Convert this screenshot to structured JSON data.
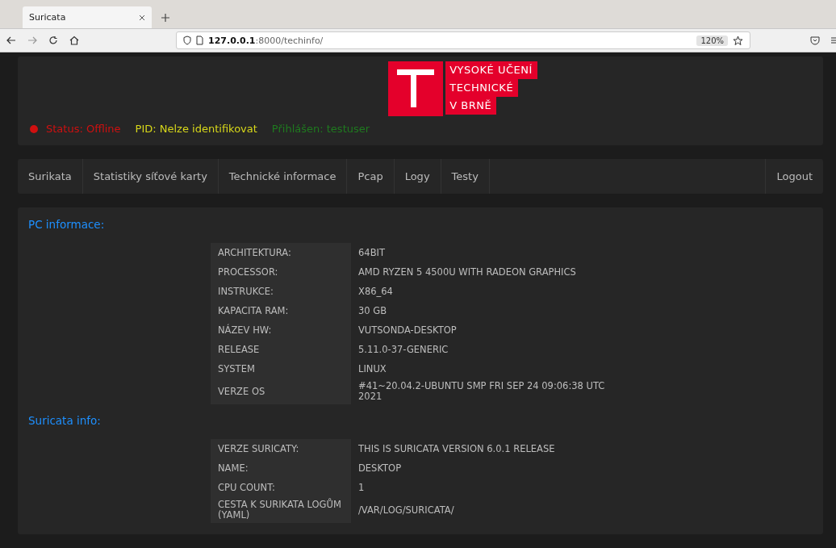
{
  "browser": {
    "tab_title": "Suricata",
    "url_host": "127.0.0.1",
    "url_rest": ":8000/techinfo/",
    "zoom": "120%"
  },
  "logo": {
    "lines": [
      "VYSOKÉ UČENÍ",
      "TECHNICKÉ",
      "V BRNĚ"
    ]
  },
  "status": [
    {
      "text": "Status: Offline",
      "color": "#d01010",
      "dot": true
    },
    {
      "text": "PID: Nelze identifikovat",
      "color": "#d8d81a",
      "dot": false
    },
    {
      "text": "Přihlášen: testuser",
      "color": "#1f7a1f",
      "dot": false
    }
  ],
  "nav": {
    "items": [
      "Surikata",
      "Statistiky síťové karty",
      "Technické informace",
      "Pcap",
      "Logy",
      "Testy"
    ],
    "right": "Logout"
  },
  "sections": [
    {
      "title": "PC informace:",
      "rows": [
        {
          "label": "ARCHITEKTURA:",
          "value": "64BIT"
        },
        {
          "label": "PROCESSOR:",
          "value": "AMD RYZEN 5 4500U WITH RADEON GRAPHICS"
        },
        {
          "label": "INSTRUKCE:",
          "value": "X86_64"
        },
        {
          "label": "KAPACITA RAM:",
          "value": "30 GB"
        },
        {
          "label": "NÁZEV HW:",
          "value": "VUTSONDA-DESKTOP"
        },
        {
          "label": "RELEASE",
          "value": "5.11.0-37-GENERIC"
        },
        {
          "label": "SYSTEM",
          "value": "LINUX"
        },
        {
          "label": "VERZE OS",
          "value": "#41~20.04.2-UBUNTU SMP FRI SEP 24 09:06:38 UTC 2021"
        }
      ]
    },
    {
      "title": "Suricata info:",
      "rows": [
        {
          "label": "VERZE SURICATY:",
          "value": "THIS IS SURICATA VERSION 6.0.1 RELEASE"
        },
        {
          "label": "NAME:",
          "value": "DESKTOP"
        },
        {
          "label": "CPU COUNT:",
          "value": "1"
        },
        {
          "label": "CESTA K SURIKATA LOGŮM (YAML)",
          "value": "/VAR/LOG/SURICATA/"
        }
      ]
    }
  ]
}
